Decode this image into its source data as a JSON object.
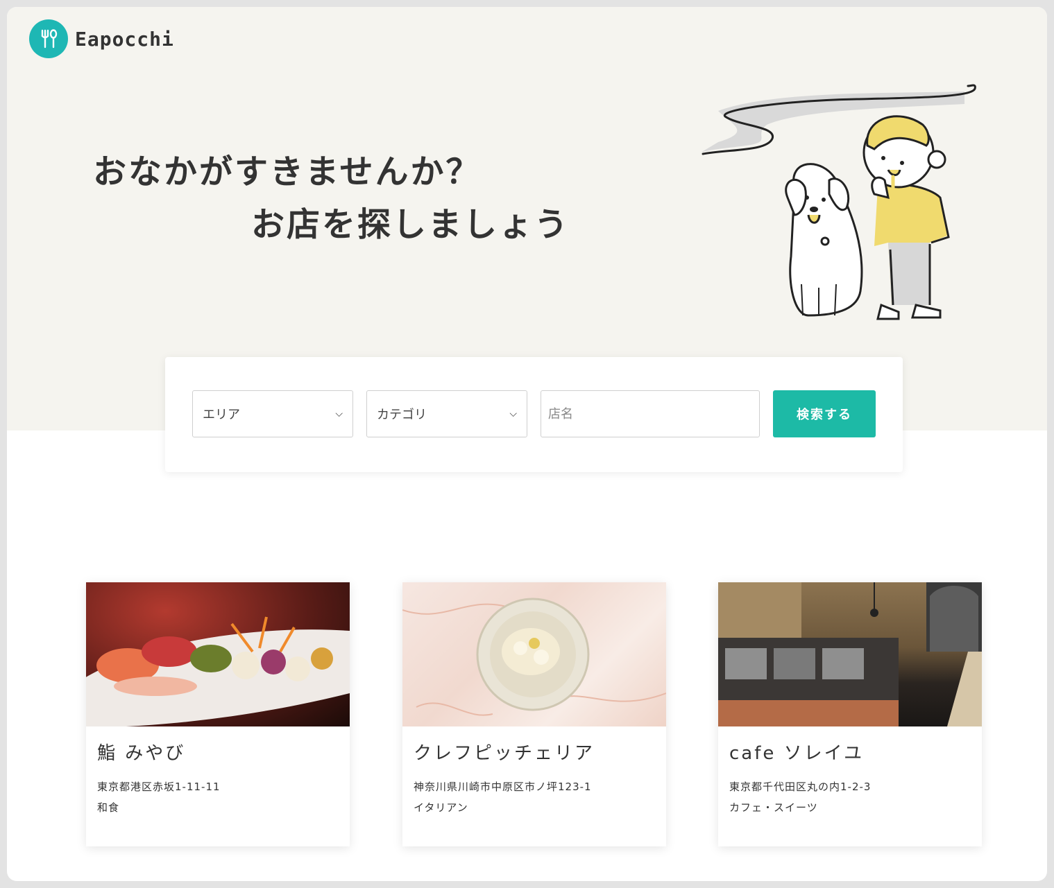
{
  "header": {
    "logo_text": "Eapocchi"
  },
  "hero": {
    "line1": "おなかがすきませんか？",
    "line2": "お店を探しましょう"
  },
  "search": {
    "area_label": "エリア",
    "category_label": "カテゴリ",
    "name_placeholder": "店名",
    "button_label": "検索する"
  },
  "restaurants": [
    {
      "name": "鮨 みやび",
      "address": "東京都港区赤坂1-11-11",
      "category": "和食"
    },
    {
      "name": "クレフピッチェリア",
      "address": "神奈川県川崎市中原区市ノ坪123-1",
      "category": "イタリアン"
    },
    {
      "name": "cafe ソレイユ",
      "address": "東京都千代田区丸の内1-2-3",
      "category": "カフェ・スイーツ"
    }
  ],
  "colors": {
    "accent": "#1dbaa6",
    "logo": "#1eb7b4",
    "hero_bg": "#f5f4ef",
    "illustration_yellow": "#f0da6e"
  }
}
